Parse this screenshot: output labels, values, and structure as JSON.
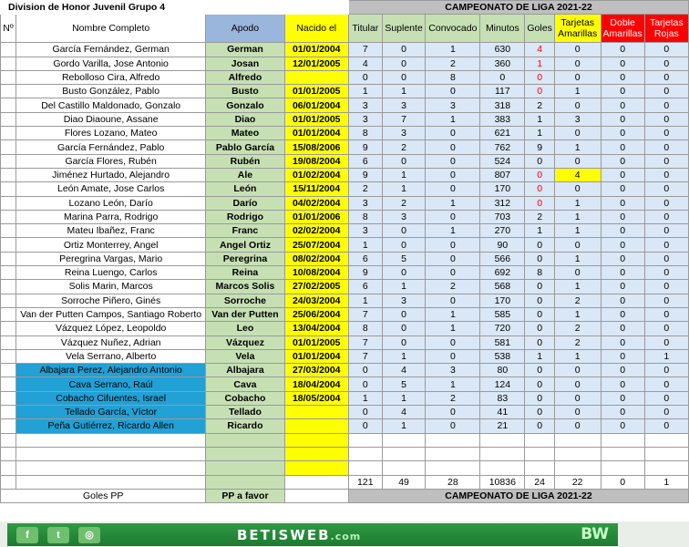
{
  "sheet": {
    "title": "Division  de Honor Juvenil Grupo 4",
    "campeonato": "CAMPEONATO  DE LIGA 2021-22",
    "headers": {
      "num": "Nº",
      "nombre": "Nombre Completo",
      "apodo": "Apodo",
      "nacido": "Nacido el",
      "titular": "Titular",
      "suplente": "Suplente",
      "convocado": "Convocado",
      "minutos": "Minutos",
      "goles": "Goles",
      "amarillas": "Tarjetas Amarillas",
      "doble": "Doble Amarillas",
      "rojas": "Tarjetas Rojas"
    },
    "players": [
      {
        "nombre": "García Fernández, German",
        "apodo": "German",
        "nacido": "01/01/2004",
        "titular": "7",
        "suplente": "0",
        "convocado": "1",
        "minutos": "630",
        "goles": "4",
        "amarillas": "0",
        "doble": "0",
        "rojas": "0"
      },
      {
        "nombre": "Gordo Varilla, Jose Antonio",
        "apodo": "Josan",
        "nacido": "12/01/2005",
        "titular": "4",
        "suplente": "0",
        "convocado": "2",
        "minutos": "360",
        "goles": "1",
        "amarillas": "0",
        "doble": "0",
        "rojas": "0"
      },
      {
        "nombre": "Rebolloso Cira, Alfredo",
        "apodo": "Alfredo",
        "nacido": "",
        "titular": "0",
        "suplente": "0",
        "convocado": "8",
        "minutos": "0",
        "goles": "0",
        "amarillas": "0",
        "doble": "0",
        "rojas": "0"
      },
      {
        "nombre": "Busto González, Pablo",
        "apodo": "Busto",
        "nacido": "01/01/2005",
        "titular": "1",
        "suplente": "1",
        "convocado": "0",
        "minutos": "117",
        "goles": "0",
        "amarillas": "1",
        "doble": "0",
        "rojas": "0"
      },
      {
        "nombre": "Del Castillo Maldonado, Gonzalo",
        "apodo": "Gonzalo",
        "nacido": "06/01/2004",
        "titular": "3",
        "suplente": "3",
        "convocado": "3",
        "minutos": "318",
        "goles": "2",
        "amarillas": "0",
        "doble": "0",
        "rojas": "0"
      },
      {
        "nombre": "Diao Diaoune, Assane",
        "apodo": "Diao",
        "nacido": "01/01/2005",
        "titular": "3",
        "suplente": "7",
        "convocado": "1",
        "minutos": "383",
        "goles": "1",
        "amarillas": "3",
        "doble": "0",
        "rojas": "0"
      },
      {
        "nombre": "Flores Lozano, Mateo",
        "apodo": "Mateo",
        "nacido": "01/01/2004",
        "titular": "8",
        "suplente": "3",
        "convocado": "0",
        "minutos": "621",
        "goles": "1",
        "amarillas": "0",
        "doble": "0",
        "rojas": "0"
      },
      {
        "nombre": "García Fernández, Pablo",
        "apodo": "Pablo García",
        "nacido": "15/08/2006",
        "titular": "9",
        "suplente": "2",
        "convocado": "0",
        "minutos": "762",
        "goles": "9",
        "amarillas": "1",
        "doble": "0",
        "rojas": "0"
      },
      {
        "nombre": "García Flores, Rubén",
        "apodo": "Rubén",
        "nacido": "19/08/2004",
        "titular": "6",
        "suplente": "0",
        "convocado": "0",
        "minutos": "524",
        "goles": "0",
        "amarillas": "0",
        "doble": "0",
        "rojas": "0"
      },
      {
        "nombre": "Jiménez Hurtado, Alejandro",
        "apodo": "Ale",
        "nacido": "01/02/2004",
        "titular": "9",
        "suplente": "1",
        "convocado": "0",
        "minutos": "807",
        "goles": "0",
        "amarillas": "4",
        "doble": "0",
        "rojas": "0"
      },
      {
        "nombre": "León Amate, Jose Carlos",
        "apodo": "León",
        "nacido": "15/11/2004",
        "titular": "2",
        "suplente": "1",
        "convocado": "0",
        "minutos": "170",
        "goles": "0",
        "amarillas": "0",
        "doble": "0",
        "rojas": "0"
      },
      {
        "nombre": "Lozano León, Darío",
        "apodo": "Darío",
        "nacido": "04/02/2004",
        "titular": "3",
        "suplente": "2",
        "convocado": "1",
        "minutos": "312",
        "goles": "0",
        "amarillas": "1",
        "doble": "0",
        "rojas": "0"
      },
      {
        "nombre": "Marina Parra, Rodrigo",
        "apodo": "Rodrigo",
        "nacido": "01/01/2006",
        "titular": "8",
        "suplente": "3",
        "convocado": "0",
        "minutos": "703",
        "goles": "2",
        "amarillas": "1",
        "doble": "0",
        "rojas": "0"
      },
      {
        "nombre": "Mateu Ibañez, Franc",
        "apodo": "Franc",
        "nacido": "02/02/2004",
        "titular": "3",
        "suplente": "0",
        "convocado": "1",
        "minutos": "270",
        "goles": "1",
        "amarillas": "1",
        "doble": "0",
        "rojas": "0"
      },
      {
        "nombre": "Ortiz Monterrey, Angel",
        "apodo": "Angel Ortiz",
        "nacido": "25/07/2004",
        "titular": "1",
        "suplente": "0",
        "convocado": "0",
        "minutos": "90",
        "goles": "0",
        "amarillas": "0",
        "doble": "0",
        "rojas": "0"
      },
      {
        "nombre": "Peregrina Vargas, Mario",
        "apodo": "Peregrina",
        "nacido": "08/02/2004",
        "titular": "6",
        "suplente": "5",
        "convocado": "0",
        "minutos": "566",
        "goles": "0",
        "amarillas": "1",
        "doble": "0",
        "rojas": "0"
      },
      {
        "nombre": "Reina Luengo, Carlos",
        "apodo": "Reina",
        "nacido": "10/08/2004",
        "titular": "9",
        "suplente": "0",
        "convocado": "0",
        "minutos": "692",
        "goles": "8",
        "amarillas": "0",
        "doble": "0",
        "rojas": "0"
      },
      {
        "nombre": "Solis Marin, Marcos",
        "apodo": "Marcos Solis",
        "nacido": "27/02/2005",
        "titular": "6",
        "suplente": "1",
        "convocado": "2",
        "minutos": "568",
        "goles": "0",
        "amarillas": "1",
        "doble": "0",
        "rojas": "0"
      },
      {
        "nombre": "Sorroche Piñero, Ginés",
        "apodo": "Sorroche",
        "nacido": "24/03/2004",
        "titular": "1",
        "suplente": "3",
        "convocado": "0",
        "minutos": "170",
        "goles": "0",
        "amarillas": "2",
        "doble": "0",
        "rojas": "0"
      },
      {
        "nombre": "Van der Putten Campos, Santiago Roberto",
        "apodo": "Van der Putten",
        "nacido": "25/06/2004",
        "titular": "7",
        "suplente": "0",
        "convocado": "1",
        "minutos": "585",
        "goles": "0",
        "amarillas": "1",
        "doble": "0",
        "rojas": "0"
      },
      {
        "nombre": "Vázquez López, Leopoldo",
        "apodo": "Leo",
        "nacido": "13/04/2004",
        "titular": "8",
        "suplente": "0",
        "convocado": "1",
        "minutos": "720",
        "goles": "0",
        "amarillas": "2",
        "doble": "0",
        "rojas": "0"
      },
      {
        "nombre": "Vázquez Nuñez, Adrian",
        "apodo": "Vázquez",
        "nacido": "01/01/2005",
        "titular": "7",
        "suplente": "0",
        "convocado": "0",
        "minutos": "581",
        "goles": "0",
        "amarillas": "2",
        "doble": "0",
        "rojas": "0"
      },
      {
        "nombre": "Vela Serrano, Alberto",
        "apodo": "Vela",
        "nacido": "01/01/2004",
        "titular": "7",
        "suplente": "1",
        "convocado": "0",
        "minutos": "538",
        "goles": "1",
        "amarillas": "1",
        "doble": "0",
        "rojas": "1"
      },
      {
        "nombre": "Albajara Perez, Alejandro Antonio",
        "apodo": "Albajara",
        "nacido": "27/03/2004",
        "titular": "0",
        "suplente": "4",
        "convocado": "3",
        "minutos": "80",
        "goles": "0",
        "amarillas": "0",
        "doble": "0",
        "rojas": "0"
      },
      {
        "nombre": "Cava Serrano, Raúl",
        "apodo": "Cava",
        "nacido": "18/04/2004",
        "titular": "0",
        "suplente": "5",
        "convocado": "1",
        "minutos": "124",
        "goles": "0",
        "amarillas": "0",
        "doble": "0",
        "rojas": "0"
      },
      {
        "nombre": "Cobacho Cifuentes, Israel",
        "apodo": "Cobacho",
        "nacido": "18/05/2004",
        "titular": "1",
        "suplente": "1",
        "convocado": "2",
        "minutos": "83",
        "goles": "0",
        "amarillas": "0",
        "doble": "0",
        "rojas": "0"
      },
      {
        "nombre": "Tellado García, Víctor",
        "apodo": "Tellado",
        "nacido": "",
        "titular": "0",
        "suplente": "4",
        "convocado": "0",
        "minutos": "41",
        "goles": "0",
        "amarillas": "0",
        "doble": "0",
        "rojas": "0"
      },
      {
        "nombre": "Peña Gutiérrez, Ricardo Allen",
        "apodo": "Ricardo",
        "nacido": "",
        "titular": "0",
        "suplente": "1",
        "convocado": "0",
        "minutos": "21",
        "goles": "0",
        "amarillas": "0",
        "doble": "0",
        "rojas": "0"
      }
    ],
    "totals": {
      "titular": "121",
      "suplente": "49",
      "convocado": "28",
      "minutos": "10836",
      "goles": "24",
      "amarillas": "22",
      "doble": "0",
      "rojas": "1"
    },
    "footer": {
      "goles_pp": "Goles PP",
      "pp_favor": "PP a favor",
      "campeonato": "CAMPEONATO  DE LIGA 2021-22"
    }
  },
  "banner": {
    "brand": "BETISWEB",
    "brand_suffix": ".com",
    "logo": "BW",
    "icons": [
      "facebook-icon",
      "twitter-icon",
      "instagram-icon"
    ],
    "color": "#2f9a43"
  }
}
